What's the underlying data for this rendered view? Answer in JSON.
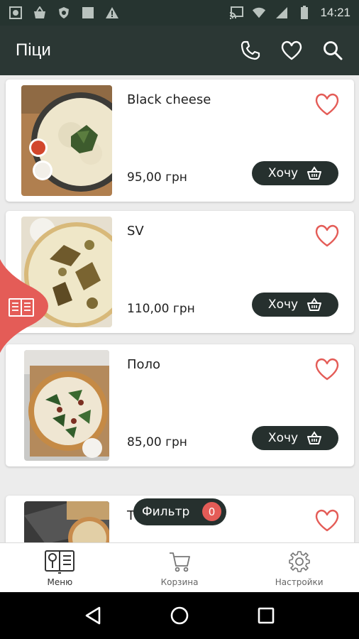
{
  "status_bar": {
    "time": "14:21",
    "left_icons": [
      "screenshot-icon",
      "basket-icon",
      "shield-icon",
      "square-icon",
      "warning-icon"
    ],
    "right_icons": [
      "cast-icon",
      "wifi-icon",
      "signal-icon",
      "battery-icon"
    ]
  },
  "app_bar": {
    "title": "Піци",
    "actions": [
      "phone-icon",
      "heart-icon",
      "search-icon"
    ]
  },
  "products": [
    {
      "name": "Black cheese",
      "price": "95,00 грн",
      "button_label": "Хочу"
    },
    {
      "name": "SV",
      "price": "110,00 грн",
      "button_label": "Хочу"
    },
    {
      "name": "Поло",
      "price": "85,00 грн",
      "button_label": "Хочу"
    },
    {
      "name": "Т",
      "price": "",
      "button_label": ""
    }
  ],
  "filter": {
    "label": "Фильтр",
    "count": "0"
  },
  "bottom_nav": [
    {
      "label": "Меню",
      "icon": "menu-book-icon",
      "active": true
    },
    {
      "label": "Корзина",
      "icon": "cart-icon",
      "active": false
    },
    {
      "label": "Настройки",
      "icon": "gear-icon",
      "active": false
    }
  ],
  "colors": {
    "app_bar": "#2b3734",
    "accent": "#e45c57",
    "button_dark": "#26302e",
    "background": "#ececec"
  }
}
